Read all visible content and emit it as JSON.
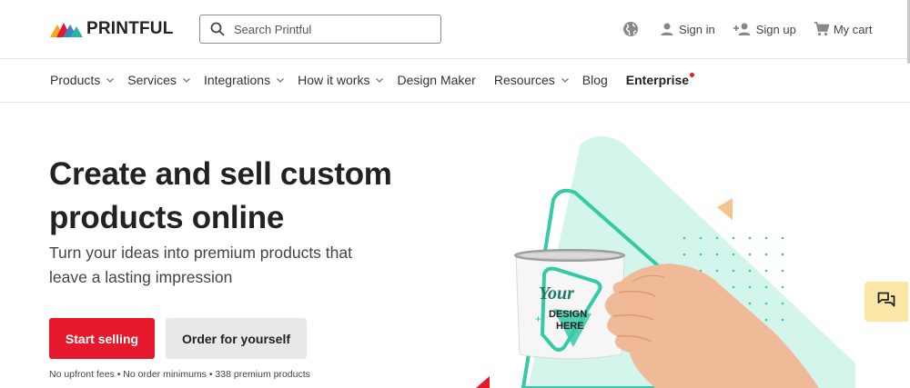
{
  "brand": {
    "name": "PRINTFUL"
  },
  "search": {
    "placeholder": "Search Printful"
  },
  "header_actions": {
    "sign_in": "Sign in",
    "sign_up": "Sign up",
    "cart": "My cart"
  },
  "nav": {
    "items": [
      {
        "label": "Products",
        "has_dropdown": true
      },
      {
        "label": "Services",
        "has_dropdown": true
      },
      {
        "label": "Integrations",
        "has_dropdown": true
      },
      {
        "label": "How it works",
        "has_dropdown": true
      },
      {
        "label": "Design Maker",
        "has_dropdown": false
      },
      {
        "label": "Resources",
        "has_dropdown": true
      },
      {
        "label": "Blog",
        "has_dropdown": false
      },
      {
        "label": "Enterprise",
        "has_dropdown": false
      }
    ]
  },
  "hero": {
    "title_line1": "Create and sell custom",
    "title_line2": "products online",
    "subtitle_line1": "Turn your ideas into premium products that",
    "subtitle_line2": "leave a lasting impression",
    "primary_cta": "Start selling",
    "secondary_cta": "Order for yourself",
    "note": "No upfront fees • No order minimums • 338 premium products"
  },
  "mug": {
    "line1": "Your",
    "line2": "DESIGN",
    "line3": "HERE"
  },
  "colors": {
    "accent": "#e5192b",
    "mint": "#d4f5ec",
    "teal": "#35c9a6",
    "chat_bg": "#fbe6a8"
  },
  "icons": [
    "search-icon",
    "globe-icon",
    "user-icon",
    "add-user-icon",
    "cart-icon",
    "chevron-down-icon",
    "chat-icon"
  ]
}
